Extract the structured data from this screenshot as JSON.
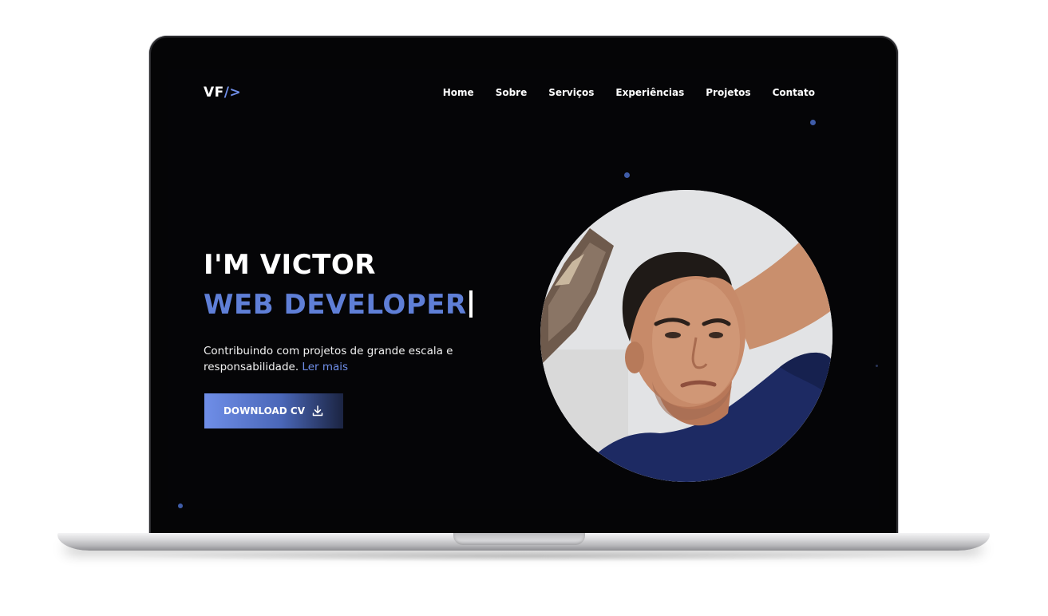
{
  "site": {
    "logo": {
      "text_main": "VF",
      "text_accent": "/>"
    },
    "nav": [
      {
        "label": "Home"
      },
      {
        "label": "Sobre"
      },
      {
        "label": "Serviços"
      },
      {
        "label": "Experiências"
      },
      {
        "label": "Projetos"
      },
      {
        "label": "Contato"
      }
    ],
    "hero": {
      "greeting": "I'M VICTOR",
      "role": "WEB DEVELOPER",
      "description": "Contribuindo com projetos de grande escala e responsabilidade.",
      "read_more": "Ler mais",
      "download_button": "DOWNLOAD CV"
    },
    "colors": {
      "background": "#050507",
      "accent": "#5f7fd7",
      "link": "#6f8ee8",
      "text": "#ffffff"
    },
    "icons": {
      "download": "download-icon",
      "portrait": "profile-photo"
    }
  }
}
